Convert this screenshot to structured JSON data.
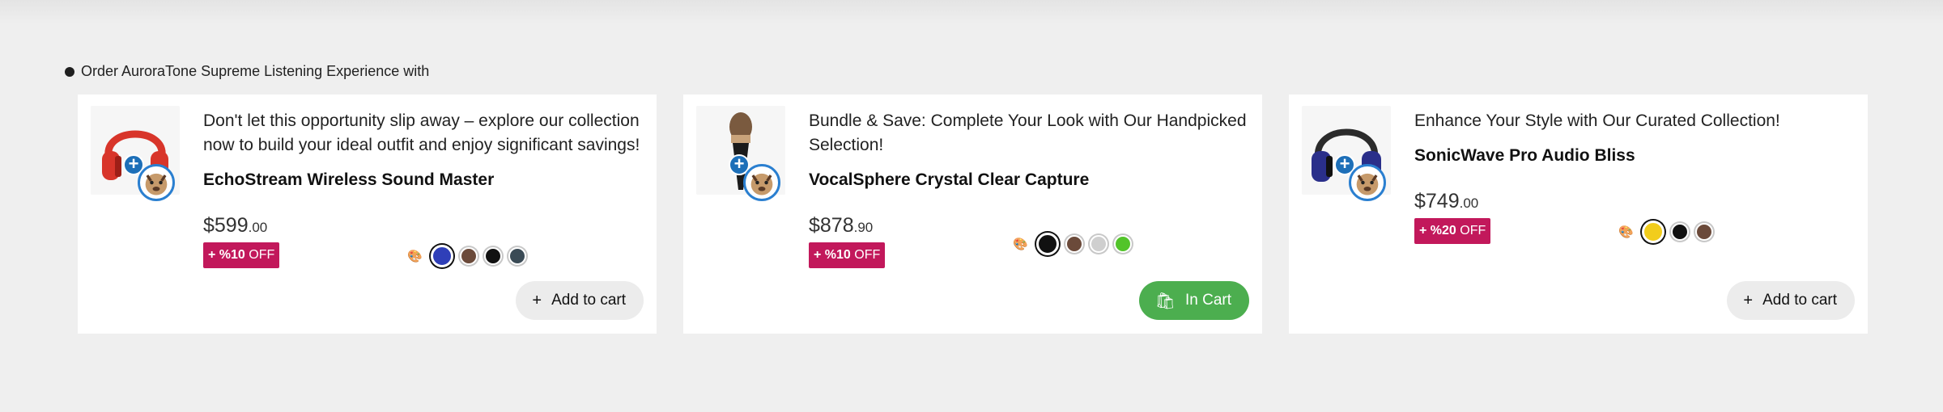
{
  "heading": {
    "text": "Order AuroraTone Supreme Listening Experience with"
  },
  "products": [
    {
      "promo": "Don't let this opportunity slip away – explore our collection now to build your ideal outfit and enjoy significant savings!",
      "name": "EchoStream Wireless Sound Master",
      "price_main": "$599",
      "price_cents": ".00",
      "discount_value": "+ %10",
      "discount_suffix": "OFF",
      "image_icon": "headphones-red",
      "swatches": [
        "#2f3fb8",
        "#6b4a3a",
        "#111111",
        "#3a4a55"
      ],
      "selected_swatch": 0,
      "cart_label": "Add to cart",
      "cart_state": "add"
    },
    {
      "promo": "Bundle & Save: Complete Your Look with Our Handpicked Selection!",
      "name": "VocalSphere Crystal Clear Capture",
      "price_main": "$878",
      "price_cents": ".90",
      "discount_value": "+ %10",
      "discount_suffix": "OFF",
      "image_icon": "microphone",
      "swatches": [
        "#111111",
        "#6b4a3a",
        "#cfcfcf",
        "#52c42a"
      ],
      "selected_swatch": 0,
      "cart_label": "In Cart",
      "cart_state": "in"
    },
    {
      "promo": "Enhance Your Style with Our Curated Collection!",
      "name": "SonicWave Pro Audio Bliss",
      "price_main": "$749",
      "price_cents": ".00",
      "discount_value": "+ %20",
      "discount_suffix": "OFF",
      "image_icon": "headphones-blue",
      "swatches": [
        "#f2cd1c",
        "#111111",
        "#6b4a3a"
      ],
      "selected_swatch": 0,
      "cart_label": "Add to cart",
      "cart_state": "add"
    }
  ]
}
